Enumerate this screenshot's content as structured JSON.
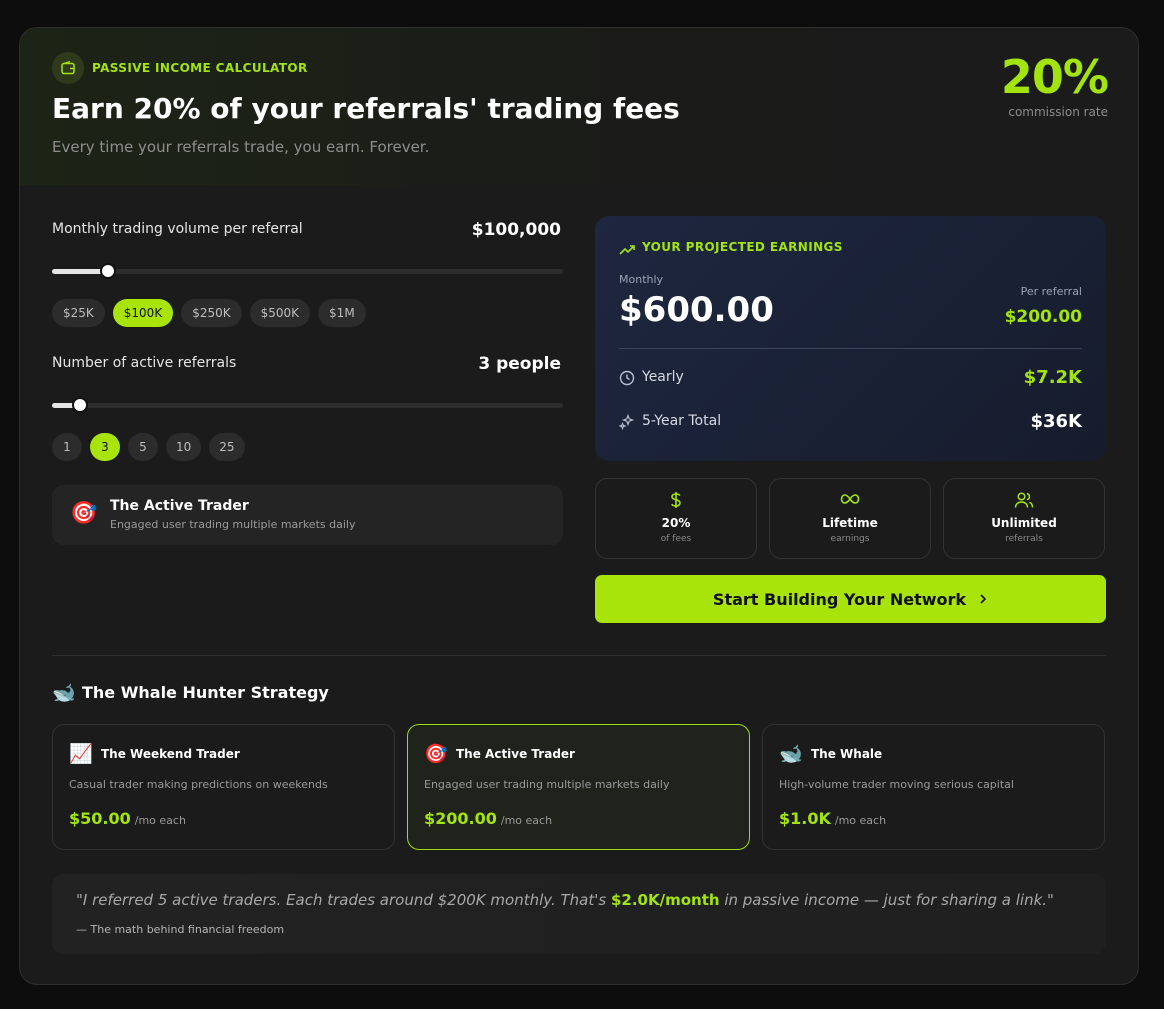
{
  "header": {
    "eyebrow": "PASSIVE INCOME CALCULATOR",
    "title": "Earn 20% of your referrals' trading fees",
    "subtitle": "Every time your referrals trade, you earn. Forever.",
    "rate": "20%",
    "rate_label": "commission rate"
  },
  "volume": {
    "label": "Monthly trading volume per referral",
    "value": "$100,000",
    "slider_level": 0.11,
    "chips": [
      "$25K",
      "$100K",
      "$250K",
      "$500K",
      "$1M"
    ],
    "active_chip": "$100K"
  },
  "referrals": {
    "label": "Number of active referrals",
    "value": "3 people",
    "slider_level": 0.055,
    "chips": [
      "1",
      "3",
      "5",
      "10",
      "25"
    ],
    "active_chip": "3"
  },
  "persona": {
    "emoji": "🎯",
    "name": "The Active Trader",
    "desc": "Engaged user trading multiple markets daily"
  },
  "earnings": {
    "eyebrow": "YOUR PROJECTED EARNINGS",
    "monthly_label": "Monthly",
    "monthly_value": "$600.00",
    "per_referral_label": "Per referral",
    "per_referral_value": "$200.00",
    "yearly_label": "Yearly",
    "yearly_value": "$7.2K",
    "five_year_label": "5-Year Total",
    "five_year_value": "$36K"
  },
  "features": [
    {
      "icon": "dollar-icon",
      "main": "20%",
      "sub": "of fees"
    },
    {
      "icon": "infinity-icon",
      "main": "Lifetime",
      "sub": "earnings"
    },
    {
      "icon": "users-icon",
      "main": "Unlimited",
      "sub": "referrals"
    }
  ],
  "cta": {
    "label": "Start Building Your Network"
  },
  "strategy": {
    "emoji": "🐋",
    "title": "The Whale Hunter Strategy",
    "cards": [
      {
        "emoji": "📈",
        "name": "The Weekend Trader",
        "desc": "Casual trader making predictions on weekends",
        "price": "$50.00",
        "suffix": "/mo each"
      },
      {
        "emoji": "🎯",
        "name": "The Active Trader",
        "desc": "Engaged user trading multiple markets daily",
        "price": "$200.00",
        "suffix": "/mo each"
      },
      {
        "emoji": "🐋",
        "name": "The Whale",
        "desc": "High-volume trader moving serious capital",
        "price": "$1.0K",
        "suffix": "/mo each"
      }
    ]
  },
  "quote": {
    "before": "\"I referred 5 active traders. Each trades around $200K monthly. That's ",
    "highlight": "$2.0K/month",
    "after": " in passive income — just for sharing a link.\"",
    "author": "— The math behind financial freedom"
  },
  "colors": {
    "accent": "#a3e40e",
    "button": "#a8e30a",
    "earnings_bg": "#1e2740",
    "card_bg": "#1b1b1b"
  }
}
